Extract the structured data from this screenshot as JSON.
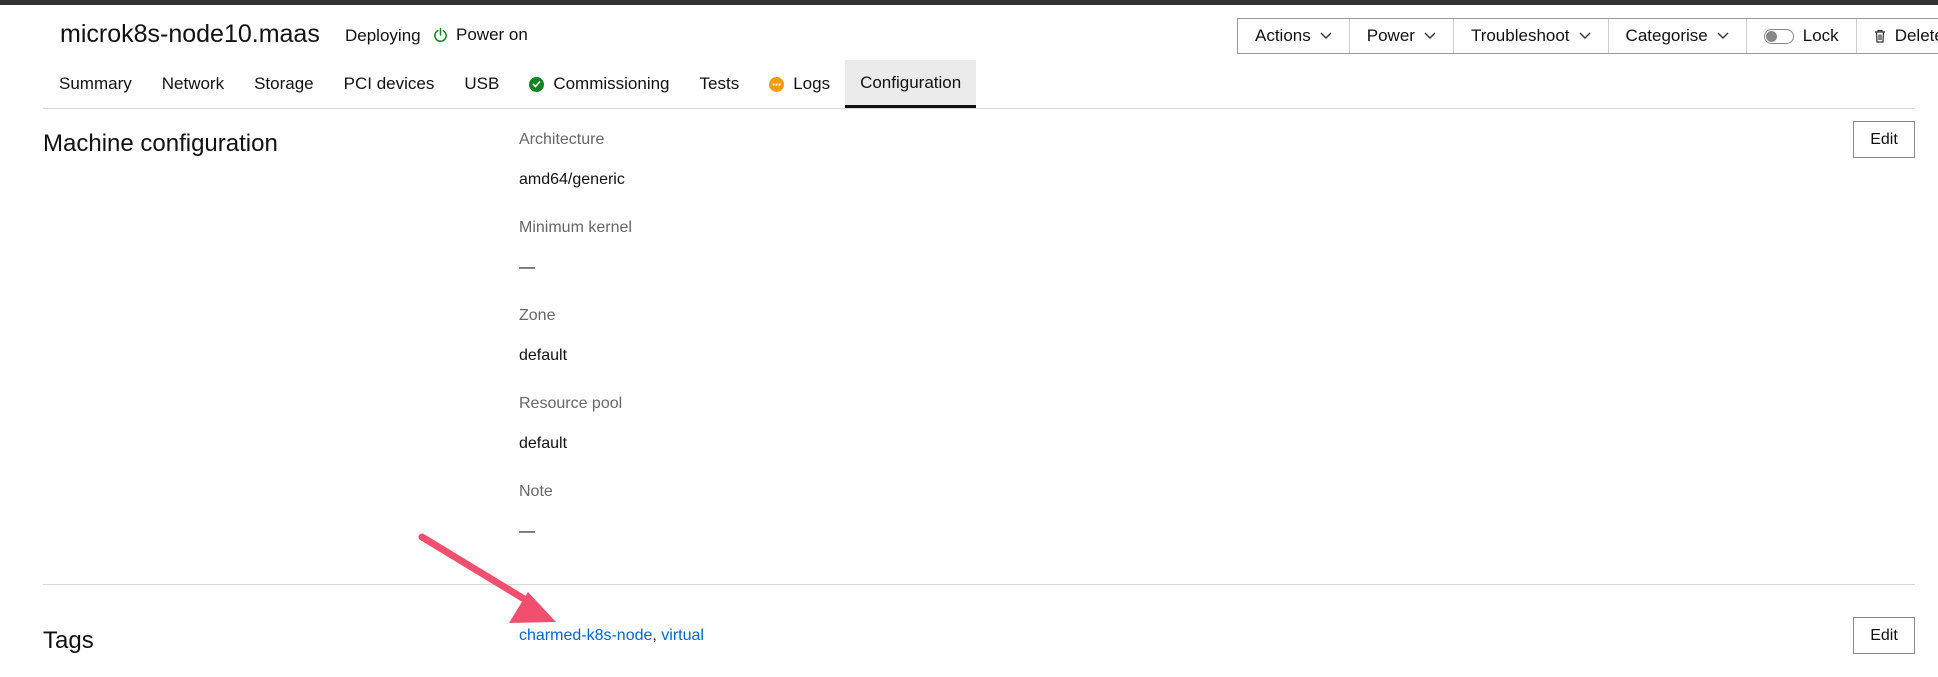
{
  "header": {
    "machine_name": "microk8s-node10.maas",
    "status": "Deploying",
    "power": "Power on",
    "colors": {
      "power_icon": "#0e8420"
    }
  },
  "actions": [
    {
      "label": "Actions",
      "icon": "chevron-down-icon"
    },
    {
      "label": "Power",
      "icon": "chevron-down-icon"
    },
    {
      "label": "Troubleshoot",
      "icon": "chevron-down-icon"
    },
    {
      "label": "Categorise",
      "icon": "chevron-down-icon"
    },
    {
      "label": "Lock",
      "icon": "toggle-switch-icon"
    },
    {
      "label": "Delete",
      "icon": "trash-icon"
    }
  ],
  "tabs": [
    {
      "label": "Summary"
    },
    {
      "label": "Network"
    },
    {
      "label": "Storage"
    },
    {
      "label": "PCI devices"
    },
    {
      "label": "USB"
    },
    {
      "label": "Commissioning",
      "icon": "success-check-icon",
      "icon_color": "#0e8420"
    },
    {
      "label": "Tests"
    },
    {
      "label": "Logs",
      "icon": "warning-dot-icon",
      "icon_color": "#f99b11"
    },
    {
      "label": "Configuration",
      "active": true
    }
  ],
  "machine_config": {
    "title": "Machine configuration",
    "edit_label": "Edit",
    "fields": [
      {
        "label": "Architecture",
        "value": "amd64/generic"
      },
      {
        "label": "Minimum kernel",
        "value": "—"
      },
      {
        "label": "Zone",
        "value": "default"
      },
      {
        "label": "Resource pool",
        "value": "default"
      },
      {
        "label": "Note",
        "value": "—"
      }
    ]
  },
  "tags_section": {
    "title": "Tags",
    "edit_label": "Edit",
    "tags": [
      "charmed-k8s-node",
      "virtual"
    ],
    "separator": ", ",
    "colors": {
      "link": "#0066cc"
    }
  },
  "annotation": {
    "type": "arrow",
    "color": "#f0506e"
  }
}
